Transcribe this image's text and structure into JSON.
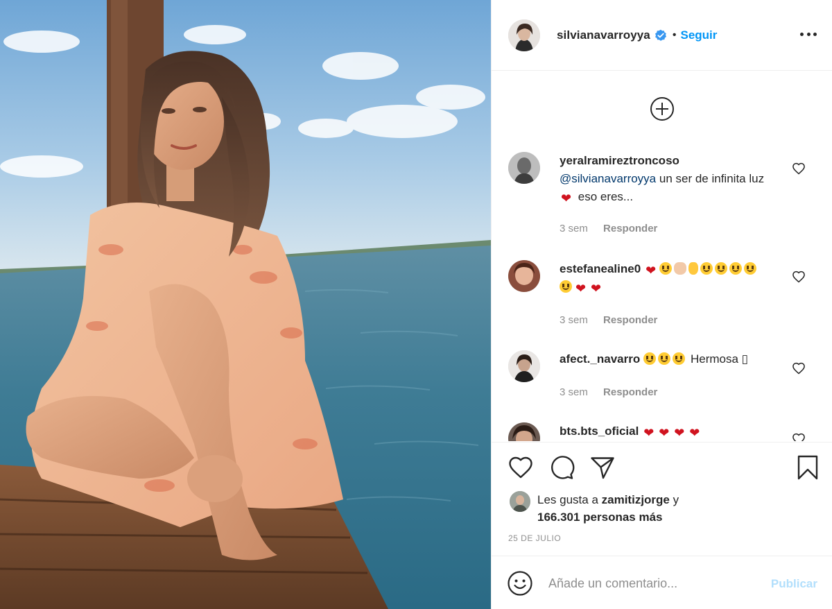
{
  "post": {
    "author": "silvianavarroyya",
    "follow_label": "Seguir",
    "dot": "•"
  },
  "comments": [
    {
      "username": "yeralramireztroncoso",
      "mention": "@silvianavarroyya",
      "text_a": "un ser de infinita luz",
      "text_b": "eso eres...",
      "time": "3 sem",
      "reply_label": "Responder"
    },
    {
      "username": "estefanealine0",
      "time": "3 sem",
      "reply_label": "Responder"
    },
    {
      "username": "afect._navarro",
      "text": "Hermosa",
      "trailing": "▯",
      "time": "3 sem",
      "reply_label": "Responder"
    },
    {
      "username": "bts.bts_oficial"
    }
  ],
  "likes": {
    "prefix": "Les gusta a",
    "user": "zamitizjorge",
    "conj": "y",
    "count": "166.301 personas más"
  },
  "date": "25 DE JULIO",
  "add_comment": {
    "placeholder": "Añade un comentario...",
    "publish_label": "Publicar"
  },
  "colors": {
    "accent": "#0095f6",
    "publish_disabled": "#b2dffc",
    "heart": "#d0131f",
    "muted": "#8e8e8e"
  },
  "icons": [
    "verified-icon",
    "more-options-icon",
    "load-more-comments-icon",
    "like-comment-icon",
    "heart-icon",
    "comment-icon",
    "share-icon",
    "save-icon",
    "emoji-icon"
  ]
}
